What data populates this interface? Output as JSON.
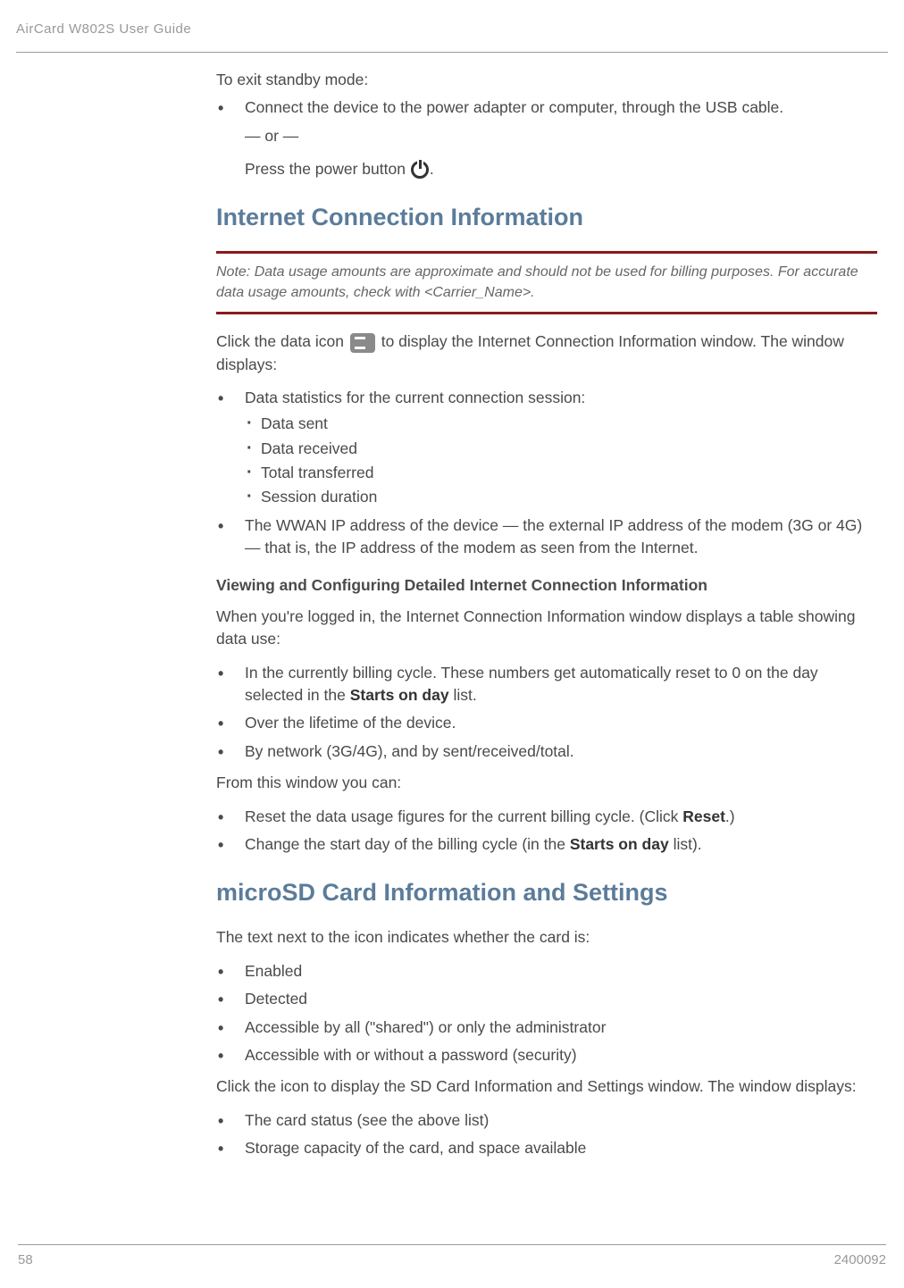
{
  "header": {
    "title": "AirCard W802S User Guide"
  },
  "intro": {
    "exit_standby": "To exit standby mode:",
    "connect_device": "Connect the device to the power adapter or computer, through the USB cable.",
    "or": "— or —",
    "press_power_pre": "Press the power button ",
    "press_power_post": "."
  },
  "sec1": {
    "heading": "Internet Connection Information",
    "note_label": "Note:",
    "note_text": " Data usage amounts are approximate and should not be used for billing purposes. For accurate data usage amounts, check with <Carrier_Name>.",
    "click_pre": "Click the data icon ",
    "click_post": " to display the Internet Connection Information window. The window displays:",
    "stats_intro": "Data statistics for the current connection session:",
    "stat_sent": "Data sent",
    "stat_received": "Data received",
    "stat_total": "Total transferred",
    "stat_duration": "Session duration",
    "wwan": "The WWAN IP address of the device — the external IP address of the modem (3G or 4G) — that is, the IP address of the modem as seen from the Internet.",
    "subheading": "Viewing and Configuring Detailed Internet Connection Information",
    "logged_in": "When you're logged in, the Internet Connection Information window displays a table showing data use:",
    "billing_pre": "In the currently billing cycle. These numbers get automatically reset to 0 on the day selected in the ",
    "starts_on_day": "Starts on day",
    "billing_post": " list.",
    "lifetime": "Over the lifetime of the device.",
    "by_network": "By network (3G/4G), and by sent/received/total.",
    "from_window": "From this window you can:",
    "reset_pre": "Reset the data usage figures for the current billing cycle. (Click ",
    "reset_label": "Reset",
    "reset_post": ".)",
    "change_pre": "Change the start day of the billing cycle (in the ",
    "change_post": " list)."
  },
  "sec2": {
    "heading": "microSD Card Information and Settings",
    "intro": "The text next to the icon indicates whether the card is:",
    "enabled": "Enabled",
    "detected": "Detected",
    "accessible_shared": "Accessible by all (\"shared\") or only the administrator",
    "accessible_pw": "Accessible with or without a password (security)",
    "click_icon": "Click the icon to display the SD Card Information and Settings window. The window displays:",
    "card_status": "The card status (see the above list)",
    "storage": "Storage capacity of the card, and space available"
  },
  "footer": {
    "page": "58",
    "docnum": "2400092"
  }
}
